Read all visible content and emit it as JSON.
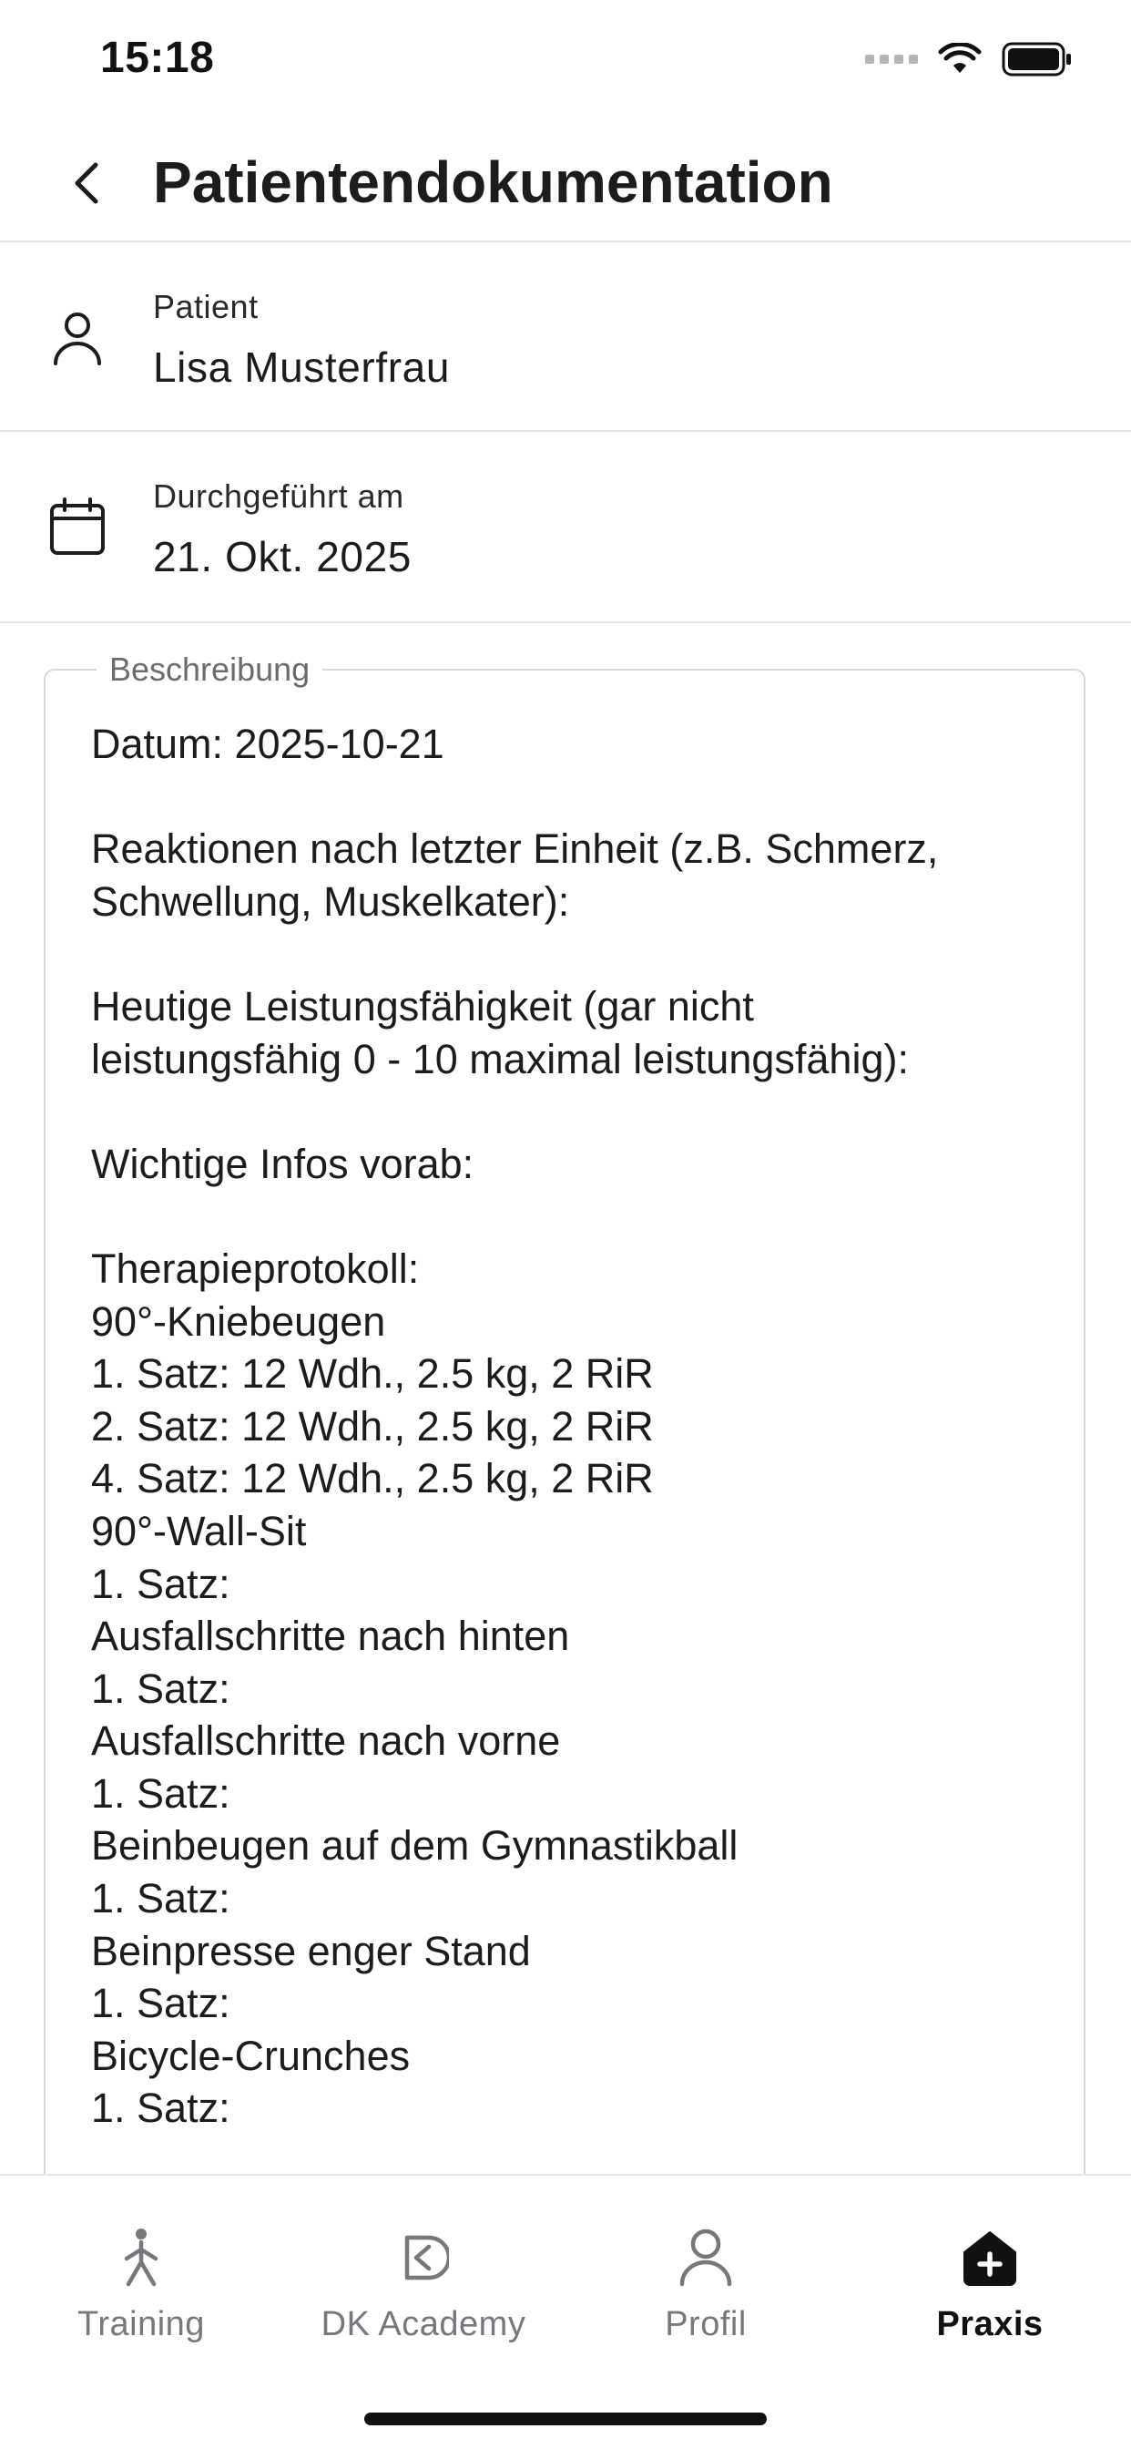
{
  "status_bar": {
    "time": "15:18"
  },
  "header": {
    "title": "Patientendokumentation"
  },
  "patient": {
    "label": "Patient",
    "value": "Lisa Musterfrau"
  },
  "date": {
    "label": "Durchgeführt am",
    "value": "21. Okt. 2025"
  },
  "description": {
    "legend": "Beschreibung",
    "text": "Datum: 2025-10-21\n\nReaktionen nach letzter Einheit (z.B. Schmerz,\nSchwellung, Muskelkater):\n\nHeutige Leistungsfähigkeit (gar nicht\nleistungsfähig 0 - 10 maximal leistungsfähig):\n\nWichtige Infos vorab:\n\nTherapieprotokoll:\n90°-Kniebeugen\n1. Satz: 12 Wdh., 2.5 kg, 2 RiR\n2. Satz: 12 Wdh., 2.5 kg, 2 RiR\n4. Satz: 12 Wdh., 2.5 kg, 2 RiR\n90°-Wall-Sit\n1. Satz:\nAusfallschritte nach hinten\n1. Satz:\nAusfallschritte nach vorne\n1. Satz:\nBeinbeugen auf dem Gymnastikball\n1. Satz:\nBeinpresse enger Stand\n1. Satz:\nBicycle-Crunches\n1. Satz:"
  },
  "nav": {
    "items": [
      {
        "label": "Training",
        "icon": "walking-person-icon",
        "active": false
      },
      {
        "label": "DK Academy",
        "icon": "academy-logo-icon",
        "active": false
      },
      {
        "label": "Profil",
        "icon": "person-icon",
        "active": false
      },
      {
        "label": "Praxis",
        "icon": "practice-plus-icon",
        "active": true
      }
    ]
  },
  "colors": {
    "text": "#1c1c1e",
    "muted": "#77777c",
    "divider": "#e4e4e6",
    "active": "#111111"
  }
}
